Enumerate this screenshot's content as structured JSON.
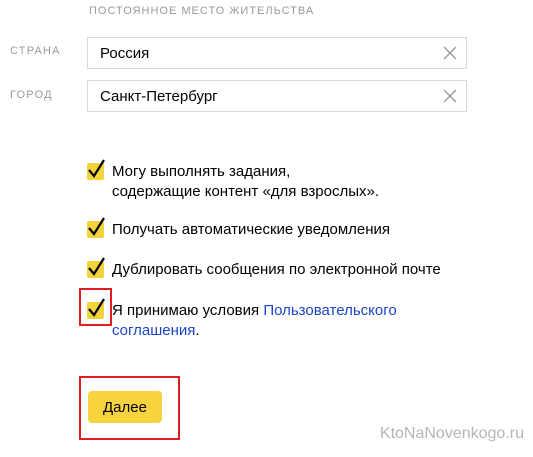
{
  "residence": {
    "section_title": "Постоянное место жительства",
    "country": {
      "label": "Страна",
      "value": "Россия"
    },
    "city": {
      "label": "Город",
      "value": "Санкт-Петербург"
    }
  },
  "checkboxes": [
    {
      "line1": "Могу выполнять задания,",
      "line2": "содержащие контент «для взрослых».",
      "checked": true
    },
    {
      "line1": "Получать автоматические уведомления",
      "checked": true
    },
    {
      "line1": "Дублировать сообщения по электронной почте",
      "checked": true
    },
    {
      "prefix": "Я принимаю условия ",
      "link1": "Пользовательского",
      "link2": "соглашения",
      "suffix": ".",
      "checked": true
    }
  ],
  "submit_label": "Далее",
  "watermark": "KtoNaNovenkogo.ru",
  "colors": {
    "accent_yellow": "#f7d33f",
    "link_blue": "#1a44c8",
    "highlight_red": "#e01b22",
    "label_gray": "#9a9a9a"
  }
}
